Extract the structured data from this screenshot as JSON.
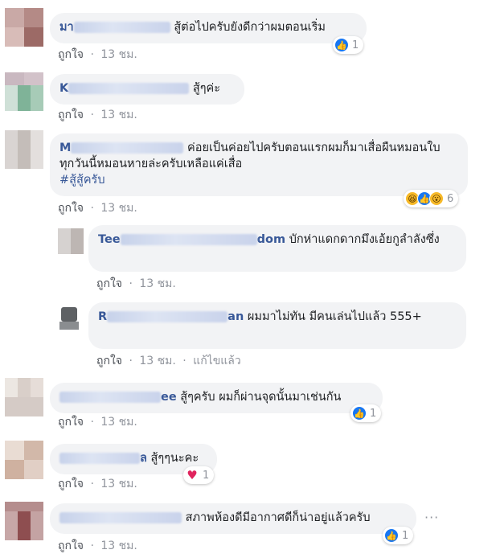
{
  "comments": [
    {
      "author": "มา",
      "text": "สู้ต่อไปครับยังดีกว่าผมตอนเริ่ม",
      "like_label": "ถูกใจ",
      "time": "13 ชม.",
      "reaction_count": "1"
    },
    {
      "author": "K",
      "text": "สู้ๆค่ะ",
      "like_label": "ถูกใจ",
      "time": "13 ชม."
    },
    {
      "author": "M",
      "text": "ค่อยเป็นค่อยไปครับตอนแรกผมก็มาเสื่อผืนหมอนใบ ทุกวันนี้หมอนหายล่ะครับเหลือแค่เสื่อ",
      "hashtag": "#สู้สู้ครับ",
      "like_label": "ถูกใจ",
      "time": "13 ชม.",
      "reaction_count": "6"
    },
    {
      "author": "Tee",
      "author_tail": "dom",
      "text": "บักห่าแดกดากมึงเอ้ยกูลำลังซึ่ง",
      "like_label": "ถูกใจ",
      "time": "13 ชม."
    },
    {
      "author": "R",
      "author_tail": "an",
      "text": "ผมมาไม่ทัน มีคนเล่นไปแล้ว 555+",
      "like_label": "ถูกใจ",
      "time": "13 ชม.",
      "edited_label": "แก้ไขแล้ว"
    },
    {
      "author_tail": "ee",
      "text": "สู้ๆครับ ผมก็ผ่านจุดนั้นมาเช่นกัน",
      "like_label": "ถูกใจ",
      "time": "13 ชม.",
      "reaction_count": "1"
    },
    {
      "author_tail": "ล",
      "text": "สู้ๆๆนะคะ",
      "like_label": "ถูกใจ",
      "time": "13 ชม.",
      "reaction_count": "1"
    },
    {
      "text": "สภาพห้องดีมีอากาศดีก็น่าอยู่แล้วครับ",
      "like_label": "ถูกใจ",
      "time": "13 ชม.",
      "reaction_count": "1",
      "more_label": "···"
    }
  ],
  "meta_separator": "·",
  "reaction_icons": {
    "like": "thumbs-up-icon",
    "haha": "haha-icon",
    "wow": "wow-icon",
    "love": "heart-icon"
  },
  "colors": {
    "author": "#385898",
    "bubble": "#f2f3f5",
    "meta": "#90949c",
    "like_blue": "#1877f2"
  }
}
